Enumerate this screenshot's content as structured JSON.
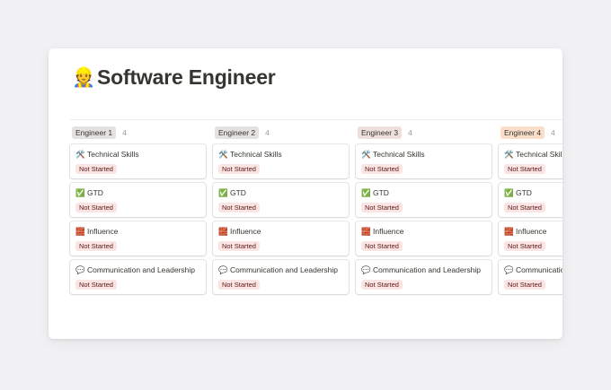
{
  "page": {
    "icon": "👷",
    "icon_name": "construction-worker-icon",
    "title": "Software Engineer"
  },
  "colors": {
    "status_not_started_bg": "#fbe4e4",
    "status_not_started_fg": "#5d1715",
    "tag_gray": "#e3e2e0",
    "tag_brown": "#eee0da",
    "tag_orange": "#fadec9"
  },
  "columns": [
    {
      "label": "Engineer 1",
      "count": "4",
      "tag_color": "#e3e2e0",
      "cards": [
        {
          "icon": "🛠️",
          "icon_name": "hammer-wrench-icon",
          "title": "Technical Skills",
          "status": "Not Started"
        },
        {
          "icon": "✅",
          "icon_name": "check-mark-icon",
          "title": "GTD",
          "status": "Not Started"
        },
        {
          "icon": "🧱",
          "icon_name": "brick-icon",
          "title": "Influence",
          "status": "Not Started"
        },
        {
          "icon": "💬",
          "icon_name": "speech-bubble-icon",
          "title": "Communication and Leadership",
          "status": "Not Started"
        }
      ]
    },
    {
      "label": "Engineer 2",
      "count": "4",
      "tag_color": "#e3e2e0",
      "cards": [
        {
          "icon": "🛠️",
          "icon_name": "hammer-wrench-icon",
          "title": "Technical Skills",
          "status": "Not Started"
        },
        {
          "icon": "✅",
          "icon_name": "check-mark-icon",
          "title": "GTD",
          "status": "Not Started"
        },
        {
          "icon": "🧱",
          "icon_name": "brick-icon",
          "title": "Influence",
          "status": "Not Started"
        },
        {
          "icon": "💬",
          "icon_name": "speech-bubble-icon",
          "title": "Communication and Leadership",
          "status": "Not Started"
        }
      ]
    },
    {
      "label": "Engineer 3",
      "count": "4",
      "tag_color": "#eee0da",
      "cards": [
        {
          "icon": "🛠️",
          "icon_name": "hammer-wrench-icon",
          "title": "Technical Skills",
          "status": "Not Started"
        },
        {
          "icon": "✅",
          "icon_name": "check-mark-icon",
          "title": "GTD",
          "status": "Not Started"
        },
        {
          "icon": "🧱",
          "icon_name": "brick-icon",
          "title": "Influence",
          "status": "Not Started"
        },
        {
          "icon": "💬",
          "icon_name": "speech-bubble-icon",
          "title": "Communication and Leadership",
          "status": "Not Started"
        }
      ]
    },
    {
      "label": "Engineer 4",
      "count": "4",
      "tag_color": "#fadec9",
      "cards": [
        {
          "icon": "🛠️",
          "icon_name": "hammer-wrench-icon",
          "title": "Technical Skills",
          "status": "Not Started"
        },
        {
          "icon": "✅",
          "icon_name": "check-mark-icon",
          "title": "GTD",
          "status": "Not Started"
        },
        {
          "icon": "🧱",
          "icon_name": "brick-icon",
          "title": "Influence",
          "status": "Not Started"
        },
        {
          "icon": "💬",
          "icon_name": "speech-bubble-icon",
          "title": "Communication and Leadership",
          "status": "Not Started"
        }
      ]
    }
  ]
}
